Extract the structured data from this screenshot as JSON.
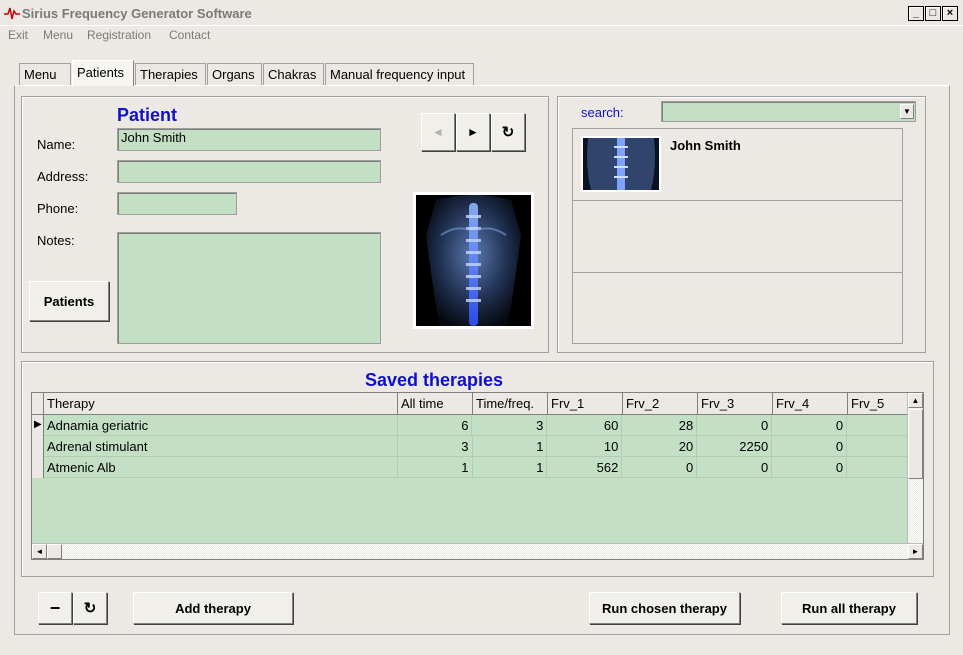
{
  "window": {
    "title": "Sirius Frequency Generator Software",
    "controls": {
      "minimize": "_",
      "maximize": "□",
      "close": "×"
    }
  },
  "menubar": [
    "Exit",
    "Menu",
    "Registration",
    "Contact"
  ],
  "tabs": [
    {
      "label": "Menu",
      "active": false
    },
    {
      "label": "Patients",
      "active": true
    },
    {
      "label": "Therapies",
      "active": false
    },
    {
      "label": "Organs",
      "active": false
    },
    {
      "label": "Chakras",
      "active": false
    },
    {
      "label": "Manual frequency input",
      "active": false
    }
  ],
  "patient": {
    "heading": "Patient",
    "name_label": "Name:",
    "name_value": "John Smith",
    "address_label": "Address:",
    "address_value": "",
    "phone_label": "Phone:",
    "phone_value": "",
    "notes_label": "Notes:",
    "notes_value": "",
    "patients_button": "Patients",
    "nav": {
      "prev": "◄",
      "next": "►",
      "refresh": "↻"
    }
  },
  "search": {
    "label": "search:",
    "value": "",
    "results": [
      {
        "name": "John Smith"
      },
      {
        "name": ""
      },
      {
        "name": ""
      }
    ]
  },
  "saved_therapies": {
    "heading": "Saved therapies",
    "columns": [
      "Therapy",
      "All time",
      "Time/freq.",
      "Frv_1",
      "Frv_2",
      "Frv_3",
      "Frv_4",
      "Frv_5"
    ],
    "rows": [
      [
        "Adnamia geriatric",
        "6",
        "3",
        "60",
        "28",
        "0",
        "0",
        ""
      ],
      [
        "Adrenal stimulant",
        "3",
        "1",
        "10",
        "20",
        "2250",
        "0",
        ""
      ],
      [
        "Atmenic Alb",
        "1",
        "1",
        "562",
        "0",
        "0",
        "0",
        ""
      ]
    ]
  },
  "bottom_bar": {
    "remove": "−",
    "refresh": "↻",
    "add_therapy": "Add therapy",
    "run_chosen": "Run chosen therapy",
    "run_all": "Run all therapy"
  },
  "colors": {
    "field_bg": "#c3dfc4",
    "heading": "#1010c8",
    "window_bg": "#ece9e4"
  }
}
